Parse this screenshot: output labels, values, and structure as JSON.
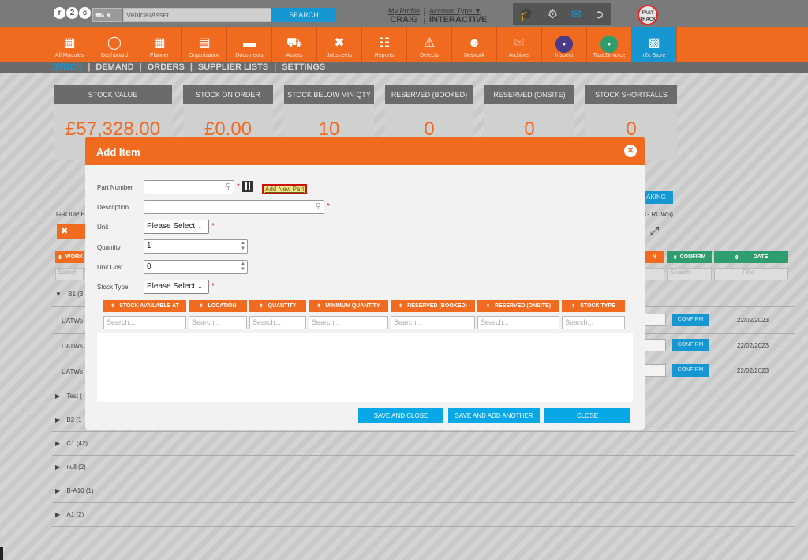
{
  "topbar": {
    "vehicle_placeholder": "Vehicle/Asset",
    "search_btn": "SEARCH",
    "profile_label": "My Profile",
    "profile_name": "CRAIG",
    "account_label": "Account Type",
    "account_value": "INTERACTIVE",
    "fast_track": "FAST TRACK"
  },
  "modules": [
    {
      "label": "All Modules",
      "icon": "grid-icon"
    },
    {
      "label": "Dashboard",
      "icon": "gauge-icon"
    },
    {
      "label": "Planner",
      "icon": "calendar-icon"
    },
    {
      "label": "Organisation",
      "icon": "buildings-icon"
    },
    {
      "label": "Documents",
      "icon": "folder-icon"
    },
    {
      "label": "Assets",
      "icon": "truck-icon"
    },
    {
      "label": "Jobsheets",
      "icon": "tools-icon"
    },
    {
      "label": "Reports",
      "icon": "clipboard-icon"
    },
    {
      "label": "Defects",
      "icon": "warning-icon"
    },
    {
      "label": "Network",
      "icon": "contact-icon"
    },
    {
      "label": "Archives",
      "icon": "archive-icon"
    },
    {
      "label": "Inspect",
      "icon": "inspect-icon"
    },
    {
      "label": "Taxe2Invoice",
      "icon": "i2i-icon"
    },
    {
      "label": "r2c Store",
      "icon": "briefcase-icon"
    }
  ],
  "subnav": {
    "stock": "STOCK",
    "demand": "DEMAND",
    "orders": "ORDERS",
    "supplier_lists": "SUPPLIER LISTS",
    "settings": "SETTINGS"
  },
  "stats": [
    {
      "label": "STOCK VALUE",
      "value": "£57,328.00"
    },
    {
      "label": "STOCK ON ORDER",
      "value": "£0.00"
    },
    {
      "label": "STOCK BELOW MIN QTY",
      "value": "10"
    },
    {
      "label": "RESERVED (BOOKED)",
      "value": "0"
    },
    {
      "label": "RESERVED (ONSITE)",
      "value": "0"
    },
    {
      "label": "STOCK SHORTFALLS",
      "value": "0"
    }
  ],
  "background": {
    "group_by": "GROUP B",
    "taking_btn": "AKING",
    "g_rows": "G ROWS)",
    "col_work": "WORK",
    "col_search": "Search",
    "col_confirm": "CONFIRM",
    "col_date": "DATE",
    "search": "Search",
    "filter": "Filte",
    "groups": [
      "B1 (3",
      "Test (",
      "B2 (1",
      "C1 (42)",
      "null (2)",
      "B-A10 (1)",
      "A1 (2)"
    ],
    "rows": [
      {
        "name": "UATWs",
        "confirm": "CONFIRM",
        "date": "22/02/2023"
      },
      {
        "name": "UATWs",
        "confirm": "CONFIRM",
        "date": "22/02/2023"
      },
      {
        "name": "UATWs",
        "confirm": "CONFIRM",
        "date": "22/02/2023"
      }
    ]
  },
  "modal": {
    "title": "Add Item",
    "part_number_label": "Part Number",
    "add_new_part": "Add New Part",
    "description_label": "Description",
    "unit_label": "Unit",
    "unit_value": "Please Select",
    "quantity_label": "Quantity",
    "quantity_value": "1",
    "unit_cost_label": "Unit Cost",
    "unit_cost_value": "0",
    "stock_type_label": "Stock Type",
    "stock_type_value": "Please Select",
    "table_headers": [
      "STOCK AVAILABLE AT",
      "LOCATION",
      "QUANTITY",
      "MINIMUM QUANTITY",
      "RESERVED (BOOKED)",
      "RESERVED (ONSITE)",
      "STOCK TYPE"
    ],
    "search_placeholder": "Search...",
    "save_and_close": "SAVE AND CLOSE",
    "save_and_add": "SAVE AND ADD ANOTHER",
    "close": "CLOSE"
  },
  "colors": {
    "accent": "#f06a1f",
    "blue": "#1797d1",
    "green": "#2e9e6e"
  }
}
